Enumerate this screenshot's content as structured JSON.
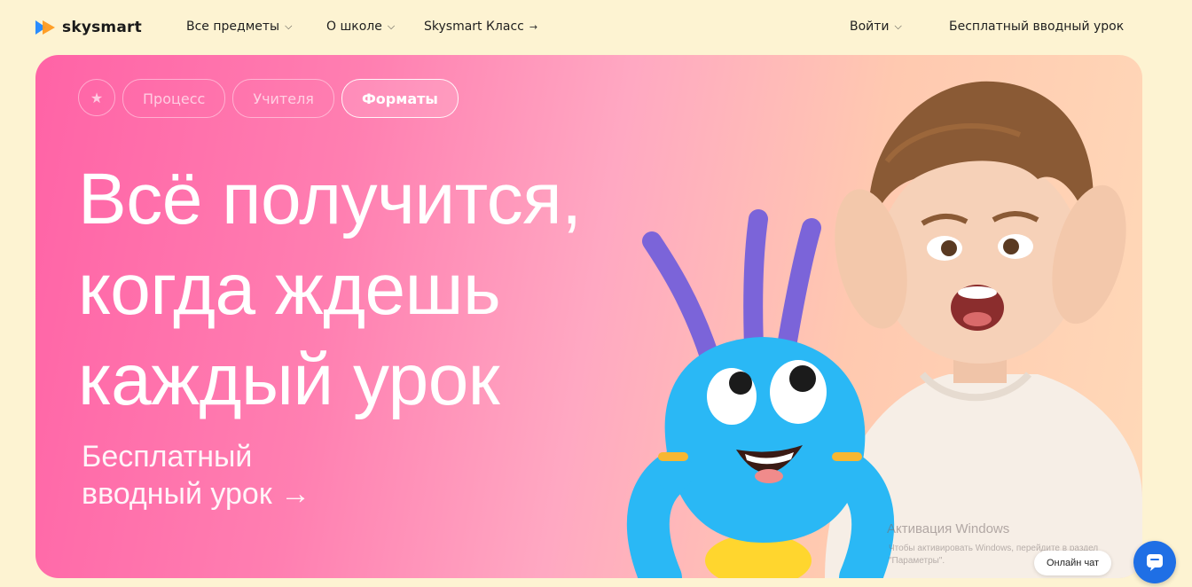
{
  "nav": {
    "logo_text": "skysmart",
    "items": [
      {
        "label": "Все предметы",
        "icon": "chevron-down-icon"
      },
      {
        "label": "О школе",
        "icon": "chevron-down-icon"
      },
      {
        "label": "Skysmart Класс",
        "icon": "arrow-right-icon"
      }
    ],
    "login_label": "Войти",
    "free_lesson_label": "Бесплатный вводный урок"
  },
  "hero": {
    "tabs": [
      {
        "label": "★",
        "icon": "star-icon"
      },
      {
        "label": "Процесс"
      },
      {
        "label": "Учителя"
      },
      {
        "label": "Форматы",
        "active": true
      }
    ],
    "headline": [
      "Всё получится,",
      "когда ждешь",
      "каждый урок"
    ],
    "cta_line1": "Бесплатный",
    "cta_line2": "вводный урок →"
  },
  "watermark": {
    "title": "Активация Windows",
    "text": "Чтобы активировать Windows, перейдите в раздел \"Параметры\"."
  },
  "chat": {
    "label": "Онлайн чат"
  },
  "colors": {
    "page_bg": "#fdf3d2",
    "hero_pink": "#ff63a6",
    "hero_peach": "#ffd9b8",
    "chat_blue": "#1f6fe5",
    "logo_orange": "#ff9a1f",
    "logo_blue": "#2a8cff"
  }
}
